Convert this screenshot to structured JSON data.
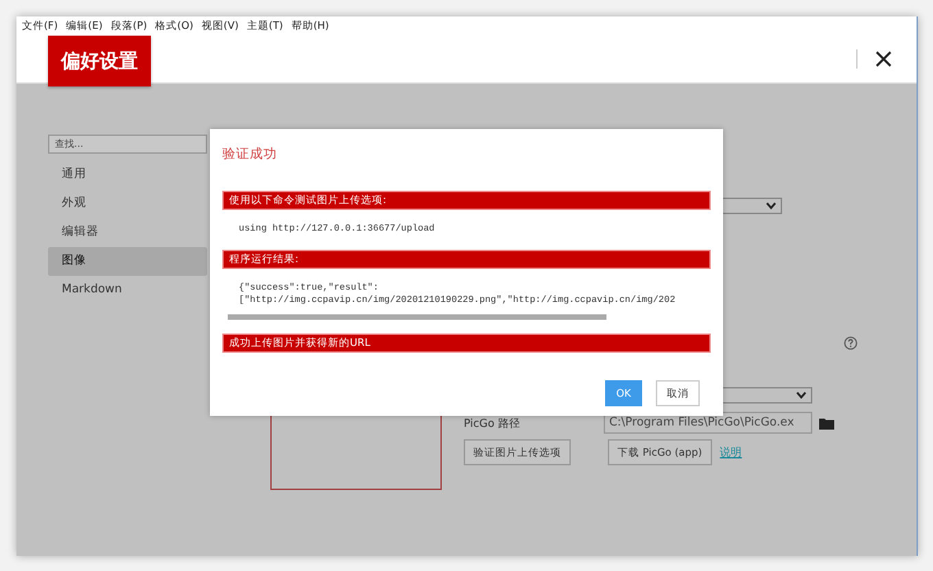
{
  "menu": [
    "文件(F)",
    "编辑(E)",
    "段落(P)",
    "格式(O)",
    "视图(V)",
    "主题(T)",
    "帮助(H)"
  ],
  "header": {
    "title": "偏好设置"
  },
  "search": {
    "placeholder": "查找..."
  },
  "sidebar": {
    "items": [
      {
        "label": "通用",
        "selected": false
      },
      {
        "label": "外观",
        "selected": false
      },
      {
        "label": "编辑器",
        "selected": false
      },
      {
        "label": "图像",
        "selected": true
      },
      {
        "label": "Markdown",
        "selected": false
      }
    ]
  },
  "settings": {
    "picgo_path_label": "PicGo 路径",
    "picgo_path_value": "C:\\Program Files\\PicGo\\PicGo.ex",
    "verify_button": "验证图片上传选项",
    "download_button": "下载 PicGo (app)",
    "help_link": "说明"
  },
  "dialog": {
    "title": "验证成功",
    "sections": [
      {
        "kind": "heading",
        "text": "使用以下命令测试图片上传选项:"
      },
      {
        "kind": "code",
        "lines": [
          "using http://127.0.0.1:36677/upload"
        ]
      },
      {
        "kind": "heading",
        "text": "程序运行结果:"
      },
      {
        "kind": "code",
        "scroll": true,
        "lines": [
          "{\"success\":true,\"result\":",
          "[\"http://img.ccpavip.cn/img/20201210190229.png\",\"http://img.ccpavip.cn/img/202"
        ]
      },
      {
        "kind": "heading",
        "text": "成功上传图片并获得新的URL"
      }
    ],
    "buttons": [
      {
        "label": "OK",
        "kind": "primary"
      },
      {
        "label": "取消",
        "kind": "secondary"
      }
    ]
  }
}
